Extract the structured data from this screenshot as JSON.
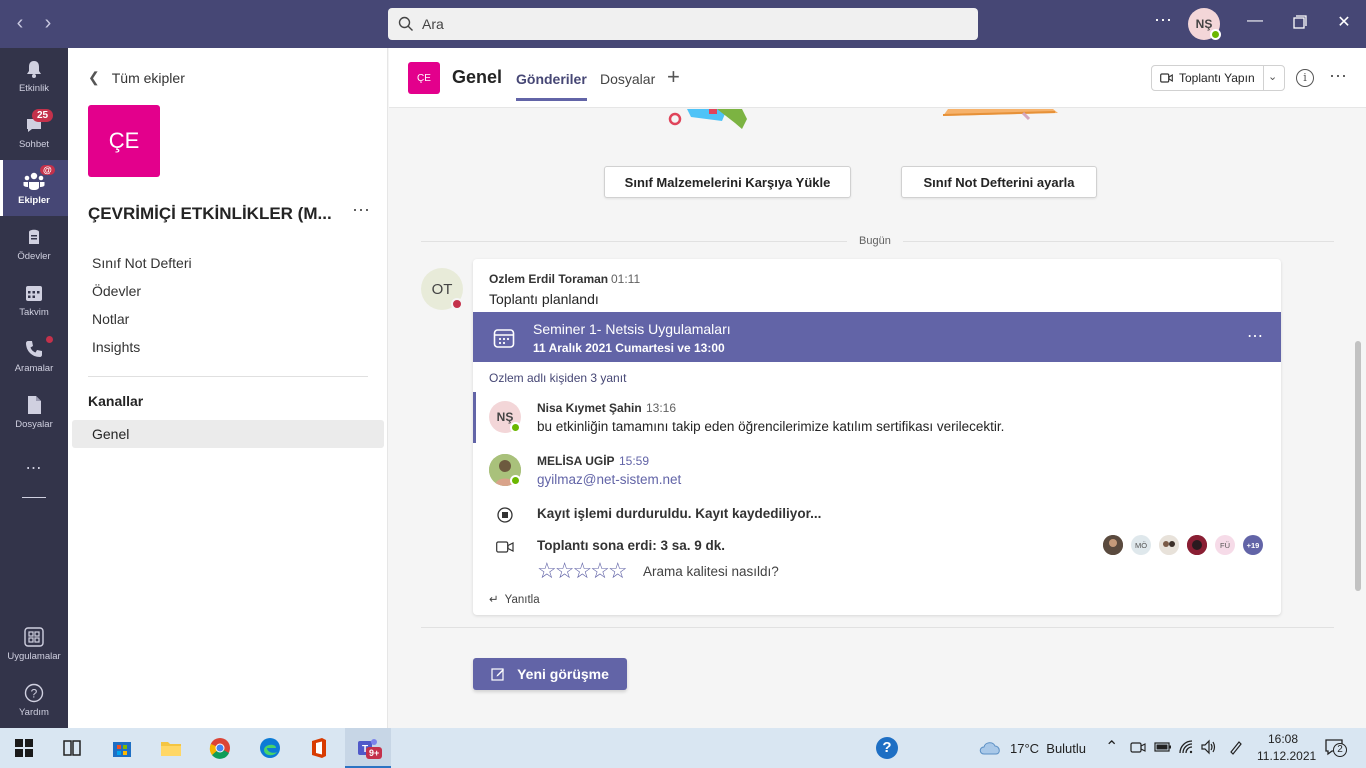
{
  "search": {
    "placeholder": "Ara"
  },
  "user": {
    "initials": "NŞ"
  },
  "rail": [
    {
      "label": "Etkinlik",
      "icon": "bell-icon"
    },
    {
      "label": "Sohbet",
      "icon": "chat-icon",
      "badge": "25"
    },
    {
      "label": "Ekipler",
      "icon": "teams-icon",
      "badge": "@"
    },
    {
      "label": "Ödevler",
      "icon": "assignments-icon"
    },
    {
      "label": "Takvim",
      "icon": "calendar-icon"
    },
    {
      "label": "Aramalar",
      "icon": "phone-icon"
    },
    {
      "label": "Dosyalar",
      "icon": "file-icon"
    },
    {
      "label": "Uygulamalar",
      "icon": "apps-icon"
    },
    {
      "label": "Yardım",
      "icon": "help-icon"
    }
  ],
  "panel": {
    "back_label": "Tüm ekipler",
    "team_initials": "ÇE",
    "team_name": "ÇEVRİMİÇİ ETKİNLİKLER (M...",
    "links": [
      "Sınıf Not Defteri",
      "Ödevler",
      "Notlar",
      "Insights"
    ],
    "channels_heading": "Kanallar",
    "channel": "Genel"
  },
  "header": {
    "tile": "ÇE",
    "title": "Genel",
    "tabs": [
      "Gönderiler",
      "Dosyalar"
    ],
    "meet_button": "Toplantı Yapın"
  },
  "feed": {
    "upload_button": "Sınıf Malzemelerini Karşıya Yükle",
    "notebook_button": "Sınıf Not Defterini ayarla",
    "today_label": "Bugün",
    "post": {
      "avatar": "OT",
      "author": "Ozlem Erdil Toraman",
      "time": "01:11",
      "text": "Toplantı planlandı",
      "meeting_title": "Seminer 1- Netsis Uygulamaları",
      "meeting_date": "11 Aralık 2021 Cumartesi ve 13:00",
      "replies_summary": "Ozlem adlı kişiden 3 yanıt",
      "replies": [
        {
          "avatar": "NŞ",
          "author": "Nisa Kıymet Şahin",
          "time": "13:16",
          "text": "bu etkinliğin tamamını takip eden öğrencilerimize katılım sertifikası verilecektir."
        },
        {
          "author": "MELİSA UGİP",
          "time": "15:59",
          "text": "gyilmaz@net-sistem.net"
        }
      ],
      "recording_text": "Kayıt işlemi durduruldu. Kayıt kaydediliyor...",
      "meeting_ended": "Toplantı sona erdi: 3 sa. 9 dk.",
      "participants": [
        "MÖ",
        "FÜ",
        "+19"
      ],
      "quality_question": "Arama kalitesi nasıldı?",
      "reply_label": "Yanıtla"
    },
    "new_conversation": "Yeni görüşme"
  },
  "taskbar": {
    "teams_badge": "9+",
    "weather": "17°C  Bulutlu",
    "time": "16:08",
    "date": "11.12.2021",
    "notifications": "2"
  },
  "colors": {
    "accent": "#6264a7",
    "title_bar": "#464775",
    "rail": "#33344a",
    "team_tile": "#e3008c"
  }
}
